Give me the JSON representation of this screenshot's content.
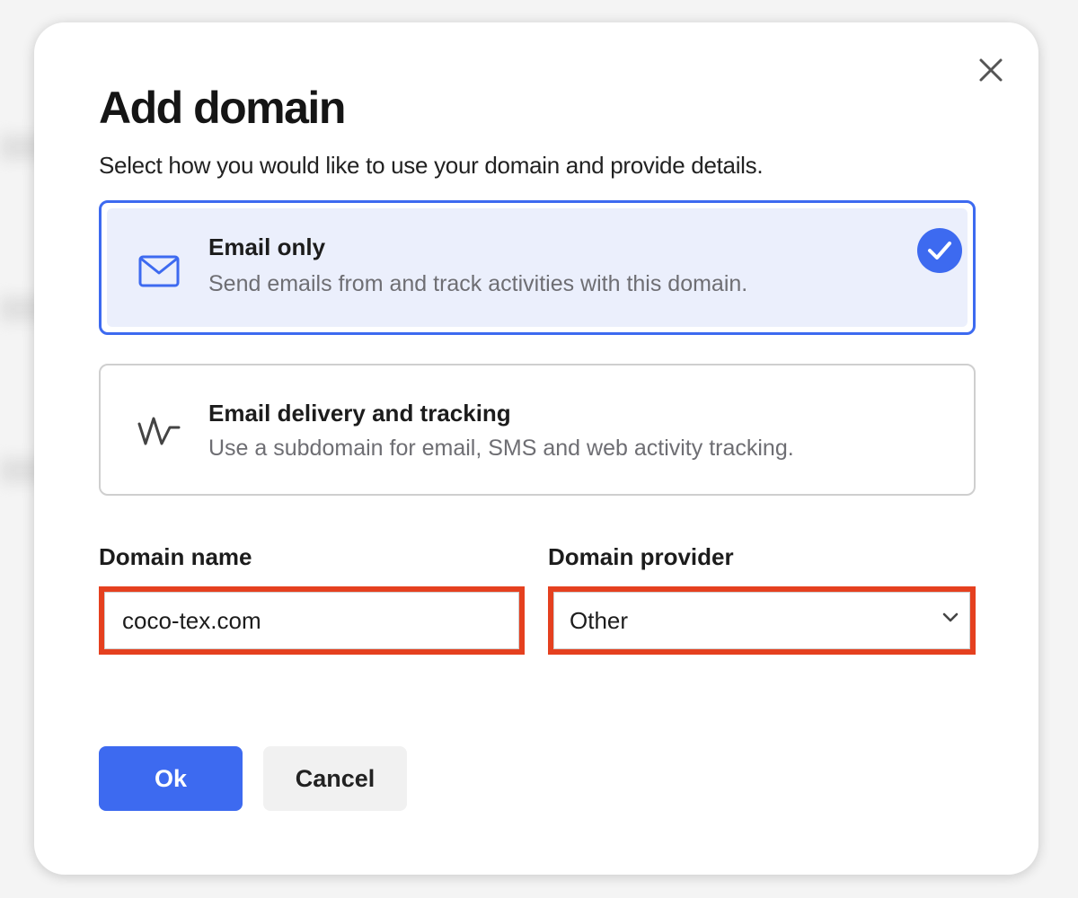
{
  "dialog": {
    "title": "Add domain",
    "subtitle": "Select how you would like to use your domain and provide details.",
    "close_icon": "close-icon"
  },
  "options": [
    {
      "title": "Email only",
      "description": "Send emails from and track activities with this domain.",
      "icon": "mail-icon",
      "selected": true
    },
    {
      "title": "Email delivery and tracking",
      "description": "Use a subdomain for email, SMS and web activity tracking.",
      "icon": "activity-wave-icon",
      "selected": false
    }
  ],
  "fields": {
    "domain_name": {
      "label": "Domain name",
      "value": "coco-tex.com"
    },
    "domain_provider": {
      "label": "Domain provider",
      "value": "Other"
    }
  },
  "buttons": {
    "ok_label": "Ok",
    "cancel_label": "Cancel"
  },
  "colors": {
    "accent": "#3d6af0",
    "selected_bg": "#ebeffc",
    "highlight_border": "#e5401f"
  }
}
